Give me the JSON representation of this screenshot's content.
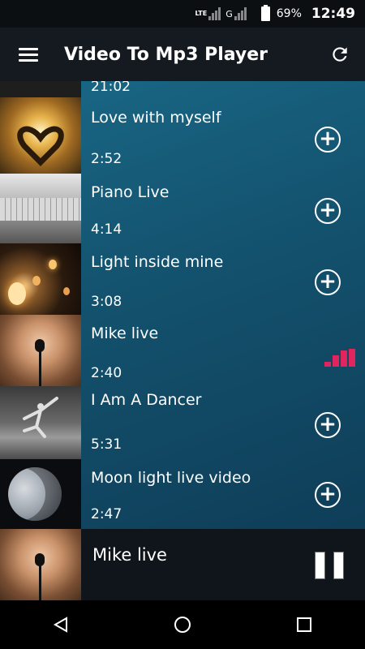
{
  "status": {
    "network": "LTE",
    "net_type": "G",
    "battery": "69%",
    "time": "12:49"
  },
  "app": {
    "title": "Video To Mp3 Player"
  },
  "list": {
    "partial_duration": "21:02",
    "items": [
      {
        "title": "Love with myself",
        "duration": "2:52"
      },
      {
        "title": "Piano Live",
        "duration": "4:14"
      },
      {
        "title": "Light inside mine",
        "duration": "3:08"
      },
      {
        "title": "Mike live",
        "duration": "2:40"
      },
      {
        "title": "I Am A Dancer",
        "duration": "5:31"
      },
      {
        "title": "Moon light live video",
        "duration": "2:47"
      }
    ]
  },
  "now_playing": {
    "title": "Mike live"
  },
  "colors": {
    "accent": "#e0245e",
    "appbar": "#141a1f",
    "background": "#13516d"
  },
  "icons": [
    "menu-icon",
    "refresh-icon",
    "add-circle-icon",
    "equalizer-icon",
    "pause-icon",
    "back-icon",
    "home-icon",
    "recents-icon"
  ]
}
